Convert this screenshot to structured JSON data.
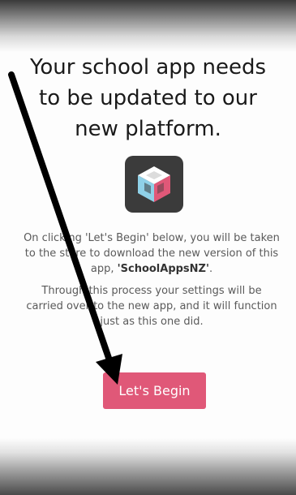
{
  "update_screen": {
    "headline": "Your school app needs to be updated to our new platform.",
    "paragraph_1_before": "On clicking 'Let's Begin' below, you will be taken to the store to download the new version of this app, ",
    "paragraph_1_app_name": "'SchoolAppsNZ'",
    "paragraph_1_after": ".",
    "paragraph_2": "Through this process your settings will be carried over to the new app, and it will function just as this one did.",
    "begin_button_label": "Let's Begin"
  },
  "app_icon": {
    "icon": "schoolapps-cube-icon",
    "colors": {
      "background": "#3b3b3b",
      "left_face": "#8fd1e8",
      "right_face": "#e05878",
      "top_face": "#ffffff"
    }
  },
  "annotation": {
    "icon": "pointer-arrow-icon",
    "color": "#000000"
  },
  "colors": {
    "accent": "#e05878",
    "body_text": "#5a5a5a",
    "headline_text": "#1a1a1a"
  }
}
